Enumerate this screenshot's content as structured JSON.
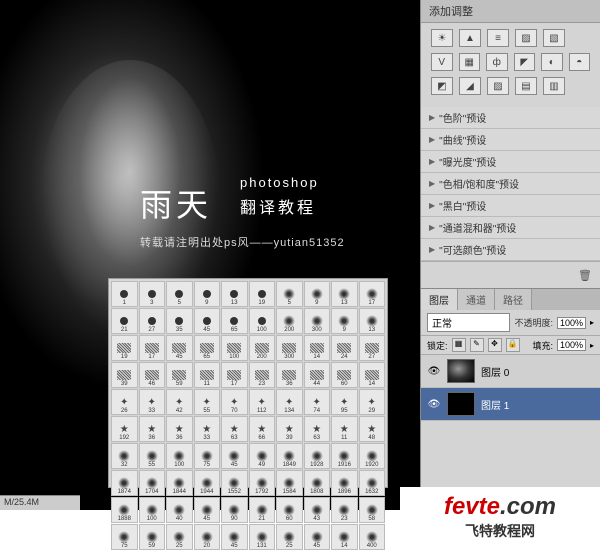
{
  "adjustments": {
    "header": "添加调整",
    "icon_row1": [
      "☀",
      "▲",
      "≡",
      "▨",
      "▧"
    ],
    "icon_row2": [
      "V",
      "▦",
      "ф",
      "◤",
      "◐",
      "◓"
    ],
    "icon_row3": [
      "◩",
      "◢",
      "▨",
      "▤",
      "▥"
    ],
    "presets": [
      "\"色阶\"预设",
      "\"曲线\"预设",
      "\"曝光度\"预设",
      "\"色相/饱和度\"预设",
      "\"黑白\"预设",
      "\"通道混和器\"预设",
      "\"可选颜色\"预设"
    ]
  },
  "layers": {
    "tabs": [
      "图层",
      "通道",
      "路径"
    ],
    "blend_mode": "正常",
    "opacity_label": "不透明度:",
    "opacity_value": "100%",
    "lock_label": "锁定:",
    "fill_label": "填充:",
    "fill_value": "100%",
    "items": [
      {
        "name": "图层 0",
        "selected": false
      },
      {
        "name": "图层 1",
        "selected": true
      }
    ]
  },
  "watermark": {
    "main": "雨天",
    "sub1": "photoshop",
    "sub2": "翻译教程",
    "credit": "转载请注明出处ps风——yutian51352"
  },
  "brushes": [
    [
      1,
      3,
      5,
      9,
      13,
      19,
      5,
      9,
      13,
      17
    ],
    [
      21,
      27,
      35,
      45,
      65,
      100,
      200,
      300,
      9,
      13
    ],
    [
      19,
      17,
      45,
      65,
      100,
      200,
      300,
      14,
      24,
      27
    ],
    [
      39,
      46,
      59,
      11,
      17,
      23,
      36,
      44,
      60,
      14
    ],
    [
      26,
      33,
      42,
      55,
      70,
      112,
      134,
      74,
      95,
      29
    ],
    [
      192,
      36,
      36,
      33,
      63,
      66,
      39,
      63,
      11,
      48
    ],
    [
      32,
      55,
      100,
      75,
      45,
      49,
      1849,
      1928,
      1916,
      1920
    ],
    [
      1874,
      1704,
      1844,
      1944,
      1552,
      1792,
      1584,
      1808,
      1896,
      1632
    ],
    [
      1888,
      100,
      40,
      45,
      90,
      21,
      60,
      43,
      23,
      58
    ],
    [
      75,
      59,
      25,
      20,
      45,
      131,
      25,
      45,
      14,
      400
    ]
  ],
  "status": "M/25.4M",
  "logo": {
    "brand": "fevte",
    "domain": ".com",
    "subtitle": "飞特教程网"
  }
}
